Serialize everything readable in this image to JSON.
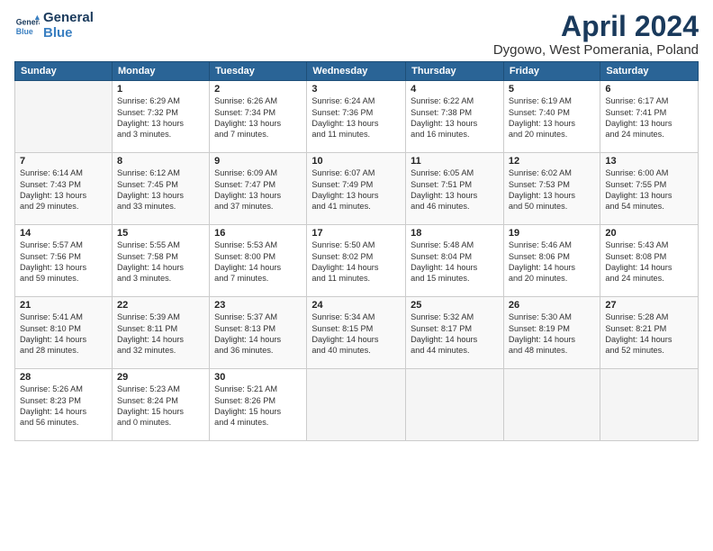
{
  "header": {
    "logo_line1": "General",
    "logo_line2": "Blue",
    "month": "April 2024",
    "location": "Dygowo, West Pomerania, Poland"
  },
  "weekdays": [
    "Sunday",
    "Monday",
    "Tuesday",
    "Wednesday",
    "Thursday",
    "Friday",
    "Saturday"
  ],
  "weeks": [
    [
      {
        "day": "",
        "info": ""
      },
      {
        "day": "1",
        "info": "Sunrise: 6:29 AM\nSunset: 7:32 PM\nDaylight: 13 hours\nand 3 minutes."
      },
      {
        "day": "2",
        "info": "Sunrise: 6:26 AM\nSunset: 7:34 PM\nDaylight: 13 hours\nand 7 minutes."
      },
      {
        "day": "3",
        "info": "Sunrise: 6:24 AM\nSunset: 7:36 PM\nDaylight: 13 hours\nand 11 minutes."
      },
      {
        "day": "4",
        "info": "Sunrise: 6:22 AM\nSunset: 7:38 PM\nDaylight: 13 hours\nand 16 minutes."
      },
      {
        "day": "5",
        "info": "Sunrise: 6:19 AM\nSunset: 7:40 PM\nDaylight: 13 hours\nand 20 minutes."
      },
      {
        "day": "6",
        "info": "Sunrise: 6:17 AM\nSunset: 7:41 PM\nDaylight: 13 hours\nand 24 minutes."
      }
    ],
    [
      {
        "day": "7",
        "info": "Sunrise: 6:14 AM\nSunset: 7:43 PM\nDaylight: 13 hours\nand 29 minutes."
      },
      {
        "day": "8",
        "info": "Sunrise: 6:12 AM\nSunset: 7:45 PM\nDaylight: 13 hours\nand 33 minutes."
      },
      {
        "day": "9",
        "info": "Sunrise: 6:09 AM\nSunset: 7:47 PM\nDaylight: 13 hours\nand 37 minutes."
      },
      {
        "day": "10",
        "info": "Sunrise: 6:07 AM\nSunset: 7:49 PM\nDaylight: 13 hours\nand 41 minutes."
      },
      {
        "day": "11",
        "info": "Sunrise: 6:05 AM\nSunset: 7:51 PM\nDaylight: 13 hours\nand 46 minutes."
      },
      {
        "day": "12",
        "info": "Sunrise: 6:02 AM\nSunset: 7:53 PM\nDaylight: 13 hours\nand 50 minutes."
      },
      {
        "day": "13",
        "info": "Sunrise: 6:00 AM\nSunset: 7:55 PM\nDaylight: 13 hours\nand 54 minutes."
      }
    ],
    [
      {
        "day": "14",
        "info": "Sunrise: 5:57 AM\nSunset: 7:56 PM\nDaylight: 13 hours\nand 59 minutes."
      },
      {
        "day": "15",
        "info": "Sunrise: 5:55 AM\nSunset: 7:58 PM\nDaylight: 14 hours\nand 3 minutes."
      },
      {
        "day": "16",
        "info": "Sunrise: 5:53 AM\nSunset: 8:00 PM\nDaylight: 14 hours\nand 7 minutes."
      },
      {
        "day": "17",
        "info": "Sunrise: 5:50 AM\nSunset: 8:02 PM\nDaylight: 14 hours\nand 11 minutes."
      },
      {
        "day": "18",
        "info": "Sunrise: 5:48 AM\nSunset: 8:04 PM\nDaylight: 14 hours\nand 15 minutes."
      },
      {
        "day": "19",
        "info": "Sunrise: 5:46 AM\nSunset: 8:06 PM\nDaylight: 14 hours\nand 20 minutes."
      },
      {
        "day": "20",
        "info": "Sunrise: 5:43 AM\nSunset: 8:08 PM\nDaylight: 14 hours\nand 24 minutes."
      }
    ],
    [
      {
        "day": "21",
        "info": "Sunrise: 5:41 AM\nSunset: 8:10 PM\nDaylight: 14 hours\nand 28 minutes."
      },
      {
        "day": "22",
        "info": "Sunrise: 5:39 AM\nSunset: 8:11 PM\nDaylight: 14 hours\nand 32 minutes."
      },
      {
        "day": "23",
        "info": "Sunrise: 5:37 AM\nSunset: 8:13 PM\nDaylight: 14 hours\nand 36 minutes."
      },
      {
        "day": "24",
        "info": "Sunrise: 5:34 AM\nSunset: 8:15 PM\nDaylight: 14 hours\nand 40 minutes."
      },
      {
        "day": "25",
        "info": "Sunrise: 5:32 AM\nSunset: 8:17 PM\nDaylight: 14 hours\nand 44 minutes."
      },
      {
        "day": "26",
        "info": "Sunrise: 5:30 AM\nSunset: 8:19 PM\nDaylight: 14 hours\nand 48 minutes."
      },
      {
        "day": "27",
        "info": "Sunrise: 5:28 AM\nSunset: 8:21 PM\nDaylight: 14 hours\nand 52 minutes."
      }
    ],
    [
      {
        "day": "28",
        "info": "Sunrise: 5:26 AM\nSunset: 8:23 PM\nDaylight: 14 hours\nand 56 minutes."
      },
      {
        "day": "29",
        "info": "Sunrise: 5:23 AM\nSunset: 8:24 PM\nDaylight: 15 hours\nand 0 minutes."
      },
      {
        "day": "30",
        "info": "Sunrise: 5:21 AM\nSunset: 8:26 PM\nDaylight: 15 hours\nand 4 minutes."
      },
      {
        "day": "",
        "info": ""
      },
      {
        "day": "",
        "info": ""
      },
      {
        "day": "",
        "info": ""
      },
      {
        "day": "",
        "info": ""
      }
    ]
  ]
}
